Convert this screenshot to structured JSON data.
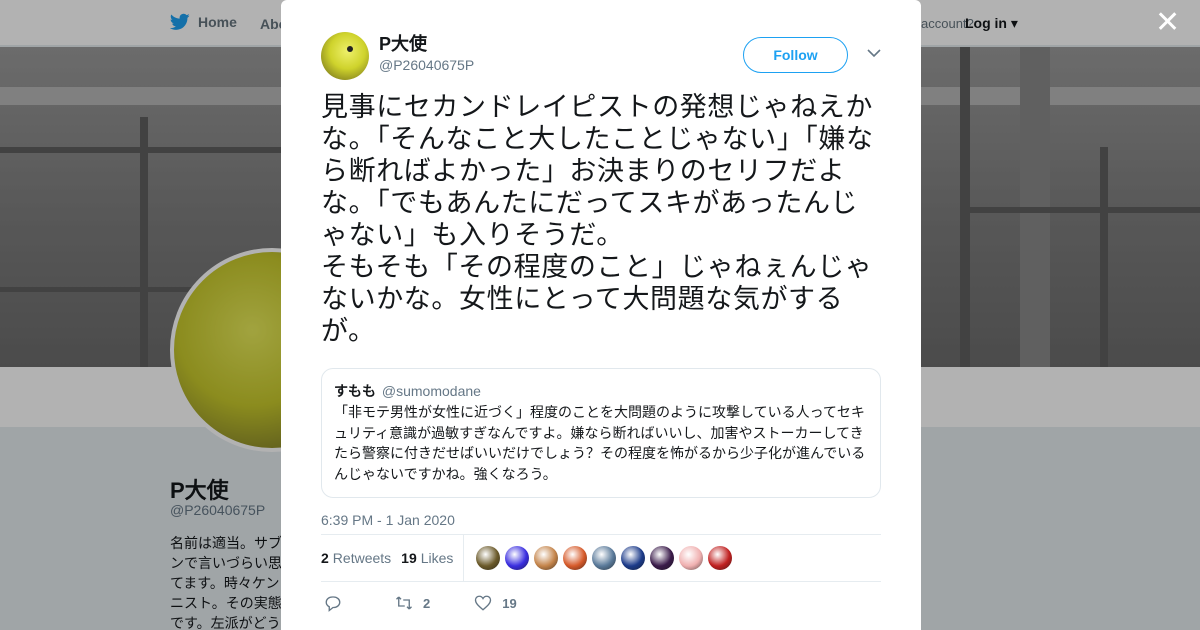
{
  "background": {
    "nav": {
      "home_label": "Home",
      "about_label": "Abo",
      "account_prompt": "account?",
      "login_label": "Log in"
    },
    "profile": {
      "name": "P大使",
      "handle": "@P26040675P",
      "bio": "名前は適当。サブンで言いづらい思てます。時々ケンニスト。その実態です。左派がどう"
    }
  },
  "tweet": {
    "author_name": "P大使",
    "author_handle": "@P26040675P",
    "follow_label": "Follow",
    "text": "見事にセカンドレイピストの発想じゃねえかな。「そんなこと大したことじゃない」「嫌なら断ればよかった」お決まりのセリフだよな。「でもあんたにだってスキがあったんじゃない」も入りそうだ。\nそもそも「その程度のこと」じゃねぇんじゃないかな。女性にとって大問題な気がするが。",
    "quote": {
      "name": "すもも",
      "handle": "@sumomodane",
      "text": "「非モテ男性が女性に近づく」程度のことを大問題のように攻撃している人ってセキュリティ意識が過敏すぎなんですよ。嫌なら断ればいいし、加害やストーカーしてきたら警察に付きだせばいいだけでしょう？その程度を怖がるから少子化が進んでいるんじゃないですかね。強くなろう。"
    },
    "timestamp": "6:39 PM - 1 Jan 2020",
    "stats": {
      "retweets_count": "2",
      "retweets_label": "Retweets",
      "likes_count": "19",
      "likes_label": "Likes"
    },
    "liker_colors": [
      "#6b5a2a",
      "#3a2ee0",
      "#c4844a",
      "#d65a2a",
      "#5a7a9a",
      "#1c3b8a",
      "#3a1b4a",
      "#f0b0b0",
      "#c02020"
    ],
    "actions": {
      "retweet_count": "2",
      "like_count": "19"
    }
  },
  "colors": {
    "accent": "#1da1f2",
    "muted": "#657786"
  },
  "icons": [
    "twitter-bird-icon",
    "close-icon",
    "chevron-down-icon",
    "reply-icon",
    "retweet-icon",
    "heart-icon"
  ]
}
